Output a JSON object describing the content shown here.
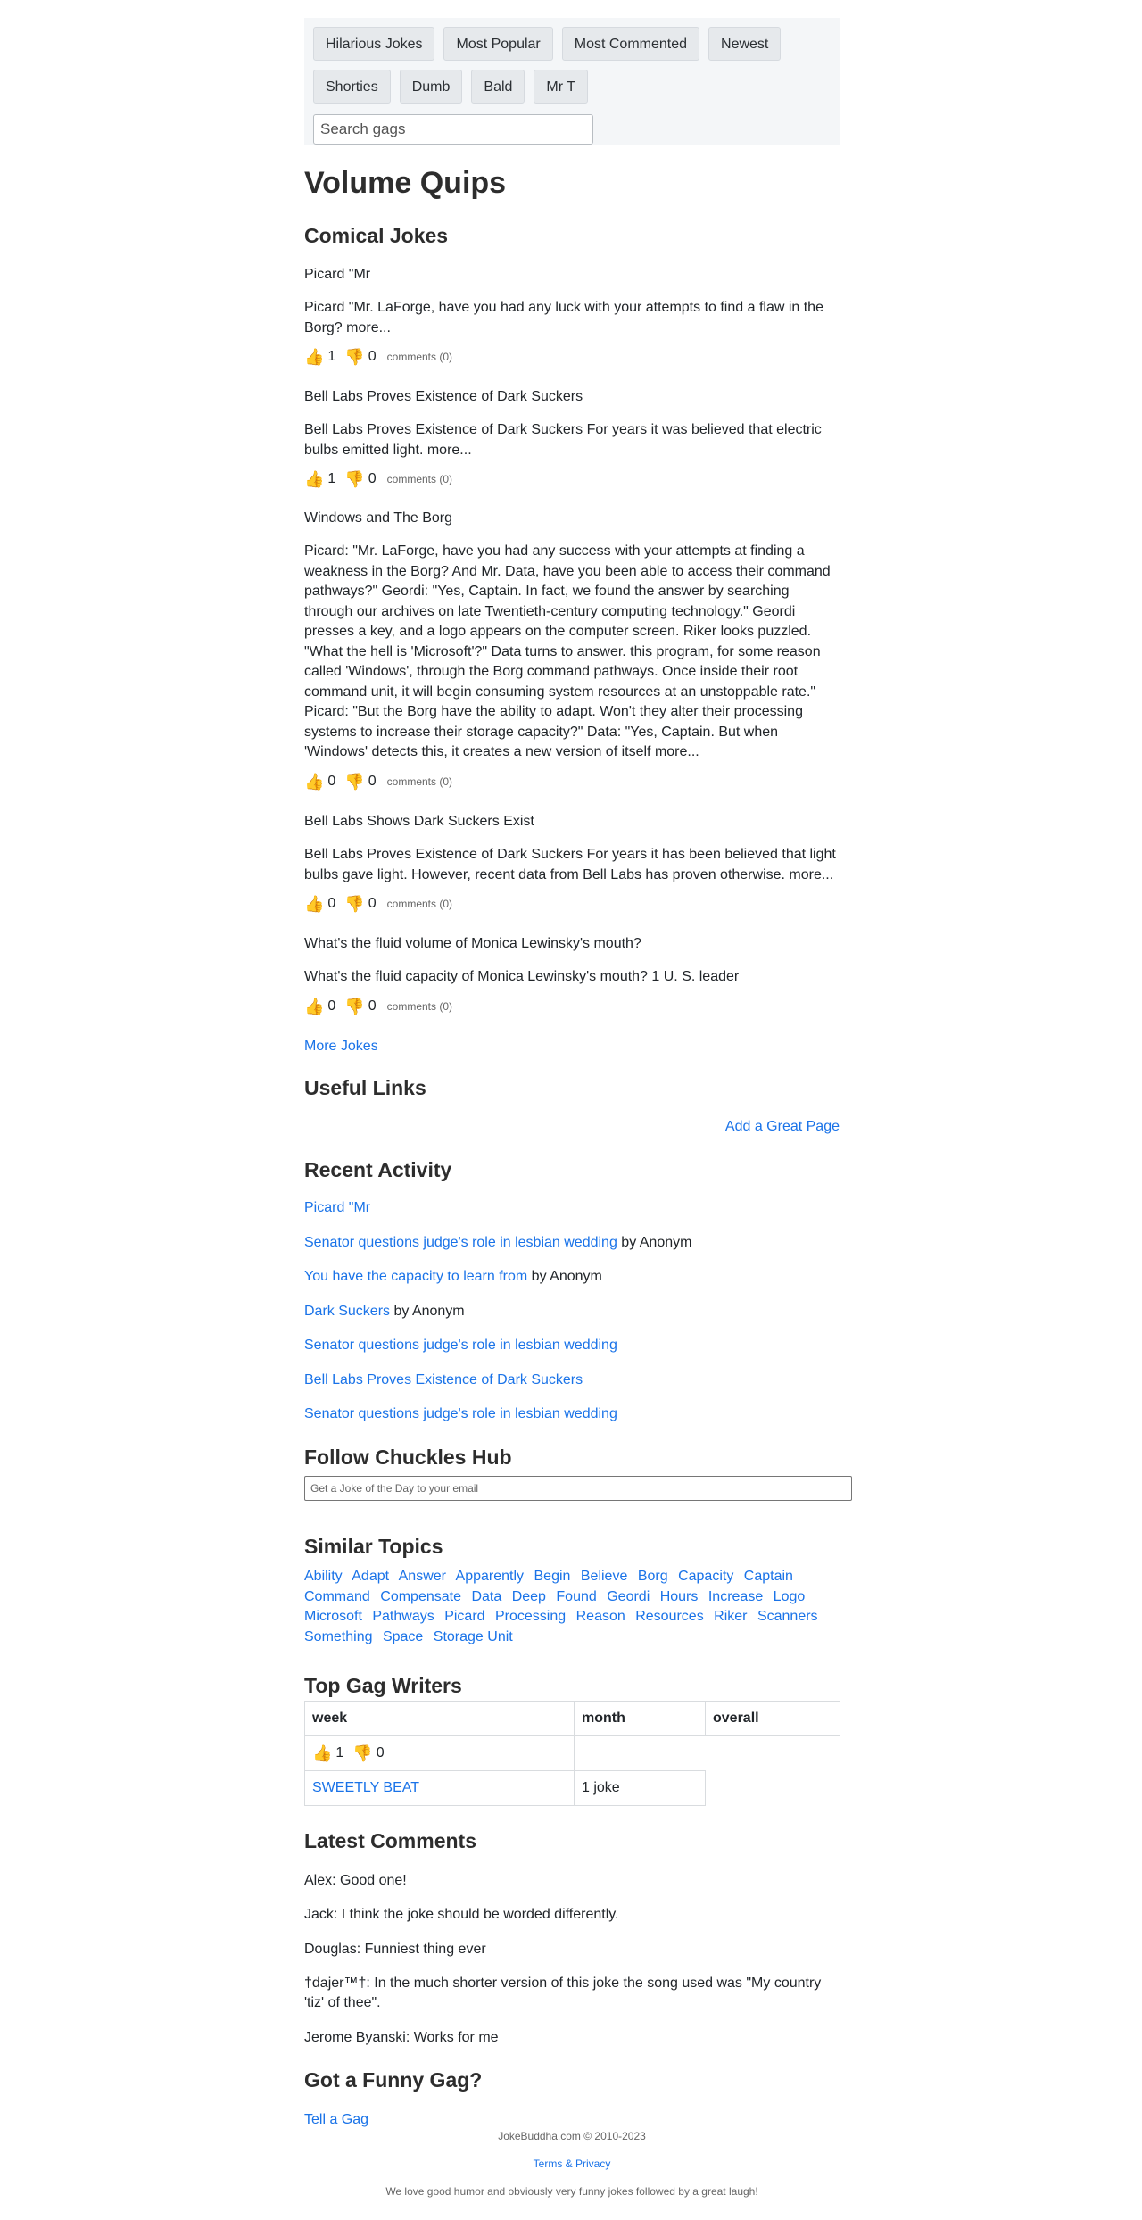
{
  "nav": {
    "buttons": [
      "Hilarious Jokes",
      "Most Popular",
      "Most Commented",
      "Newest",
      "Shorties",
      "Dumb",
      "Bald",
      "Mr T"
    ],
    "search_placeholder": "Search gags"
  },
  "page_title": "Volume Quips",
  "jokes_section": {
    "heading": "Comical Jokes",
    "jokes": [
      {
        "title": "Picard \"Mr",
        "body": "Picard \"Mr. LaForge, have you had any luck with your attempts to find a flaw in the Borg? more...",
        "up": "1",
        "down": "0",
        "comments": "comments (0)"
      },
      {
        "title": "Bell Labs Proves Existence of Dark Suckers",
        "body": "Bell Labs Proves Existence of Dark Suckers For years it was believed that electric bulbs emitted light. more...",
        "up": "1",
        "down": "0",
        "comments": "comments (0)"
      },
      {
        "title": "Windows and The Borg",
        "body": "Picard: \"Mr. LaForge, have you had any success with your attempts at finding a weakness in the Borg? And Mr. Data, have you been able to access their command pathways?\" Geordi: \"Yes, Captain. In fact, we found the answer by searching through our archives on late Twentieth-century computing technology.\" Geordi presses a key, and a logo appears on the computer screen. Riker looks puzzled. \"What the hell is 'Microsoft'?\" Data turns to answer. this program, for some reason called 'Windows', through the Borg command pathways. Once inside their root command unit, it will begin consuming system resources at an unstoppable rate.\" Picard: \"But the Borg have the ability to adapt. Won't they alter their processing systems to increase their storage capacity?\" Data: \"Yes, Captain. But when 'Windows' detects this, it creates a new version of itself more...",
        "up": "0",
        "down": "0",
        "comments": "comments (0)"
      },
      {
        "title": "Bell Labs Shows Dark Suckers Exist",
        "body": "Bell Labs Proves Existence of Dark Suckers For years it has been believed that light bulbs gave light. However, recent data from Bell Labs has proven otherwise. more...",
        "up": "0",
        "down": "0",
        "comments": "comments (0)"
      },
      {
        "title": "What's the fluid volume of Monica Lewinsky's mouth?",
        "body": "What's the fluid capacity of Monica Lewinsky's mouth? 1 U. S. leader",
        "up": "0",
        "down": "0",
        "comments": "comments (0)"
      }
    ],
    "more_link": "More Jokes"
  },
  "useful_links": {
    "heading": "Useful Links",
    "add_link": "Add a Great Page"
  },
  "recent_activity": {
    "heading": "Recent Activity",
    "items": [
      {
        "link": "Picard \"Mr",
        "suffix": ""
      },
      {
        "link": "Senator questions judge's role in lesbian wedding",
        "suffix": " by Anonym"
      },
      {
        "link": "You have the capacity to learn from",
        "suffix": " by Anonym"
      },
      {
        "link": "Dark Suckers",
        "suffix": " by Anonym"
      },
      {
        "link": "Senator questions judge's role in lesbian wedding",
        "suffix": ""
      },
      {
        "link": "Bell Labs Proves Existence of Dark Suckers",
        "suffix": ""
      },
      {
        "link": "Senator questions judge's role in lesbian wedding",
        "suffix": ""
      }
    ]
  },
  "follow": {
    "heading": "Follow Chuckles Hub",
    "email_placeholder": "Get a Joke of the Day to your email"
  },
  "similar_topics": {
    "heading": "Similar Topics",
    "topics": [
      "Ability",
      "Adapt",
      "Answer",
      "Apparently",
      "Begin",
      "Believe",
      "Borg",
      "Capacity",
      "Captain",
      "Command",
      "Compensate",
      "Data",
      "Deep",
      "Found",
      "Geordi",
      "Hours",
      "Increase",
      "Logo",
      "Microsoft",
      "Pathways",
      "Picard",
      "Processing",
      "Reason",
      "Resources",
      "Riker",
      "Scanners",
      "Something",
      "Space",
      "Storage Unit"
    ]
  },
  "top_writers": {
    "heading": "Top Gag Writers",
    "headers": [
      "week",
      "month",
      "overall"
    ],
    "votes": {
      "up": "1",
      "down": "0"
    },
    "writer_name": "SWEETLY BEAT",
    "writer_count": "1 joke"
  },
  "latest_comments": {
    "heading": "Latest Comments",
    "items": [
      "Alex: Good one!",
      "Jack: I think the joke should be worded differently.",
      "Douglas: Funniest thing ever",
      "†dajer™†: In the much shorter version of this joke the song used was \"My country 'tiz' of thee\".",
      "Jerome Byanski: Works for me"
    ]
  },
  "funny_gag": {
    "heading": "Got a Funny Gag?",
    "link": "Tell a Gag"
  },
  "footer": {
    "copyright": "JokeBuddha.com © 2010-2023",
    "terms": "Terms & Privacy",
    "tagline": "We love good humor and obviously very funny jokes followed by a great laugh!"
  },
  "icons": {
    "thumbs_up": "👍",
    "thumbs_down": "👎"
  },
  "colors": {
    "link": "#1a73e8",
    "nav_bg": "#f4f6f8"
  }
}
